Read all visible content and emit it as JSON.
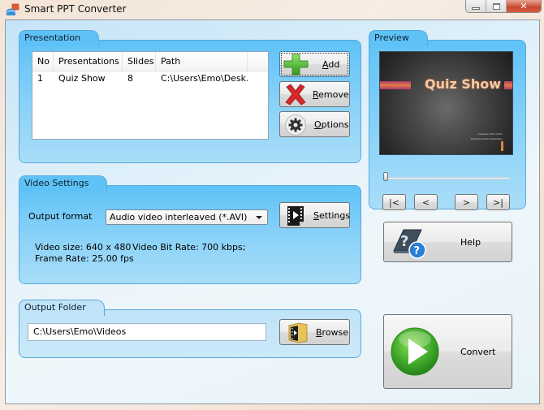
{
  "window": {
    "title": "Smart PPT Converter",
    "controls": {
      "minimize": "minimize",
      "maximize": "maximize",
      "close": "close"
    }
  },
  "presentation": {
    "group_label": "Presentation",
    "columns": [
      "No",
      "Presentations",
      "Slides",
      "Path"
    ],
    "rows": [
      {
        "no": "1",
        "name": "Quiz Show",
        "slides": "8",
        "path": "C:\\Users\\Emo\\Desk..."
      }
    ],
    "buttons": {
      "add": {
        "mnemonic": "A",
        "rest": "dd"
      },
      "remove": {
        "mnemonic": "R",
        "rest": "emove"
      },
      "options": {
        "mnemonic": "O",
        "rest": "ptions"
      }
    }
  },
  "preview": {
    "group_label": "Preview",
    "slide_title": "Quiz Show",
    "slide_subtitle_lines": [
      "xxxxxxx xxxx xxxxx",
      "xxxxxxx xxxxx xxxxxxxxx"
    ],
    "position_fraction": 0.0,
    "nav": {
      "first": "|<",
      "prev": "<",
      "next": ">",
      "last": ">|"
    }
  },
  "video_settings": {
    "group_label": "Video Settings",
    "output_format_label": "Output format",
    "output_format_value": "Audio video interleaved (*.AVI)",
    "settings_button": {
      "mnemonic": "S",
      "rest": "ettings"
    },
    "video_size": "Video size: 640 x 480",
    "bit_rate": "Video Bit Rate: 700 kbps;",
    "frame_rate": "Frame Rate: 25.00 fps"
  },
  "output_folder": {
    "group_label": "Output Folder",
    "path_value": "C:\\Users\\Emo\\Videos",
    "browse_button": {
      "mnemonic": "B",
      "rest": "rowse"
    }
  },
  "help_button": "Help",
  "convert_button": "Convert"
}
